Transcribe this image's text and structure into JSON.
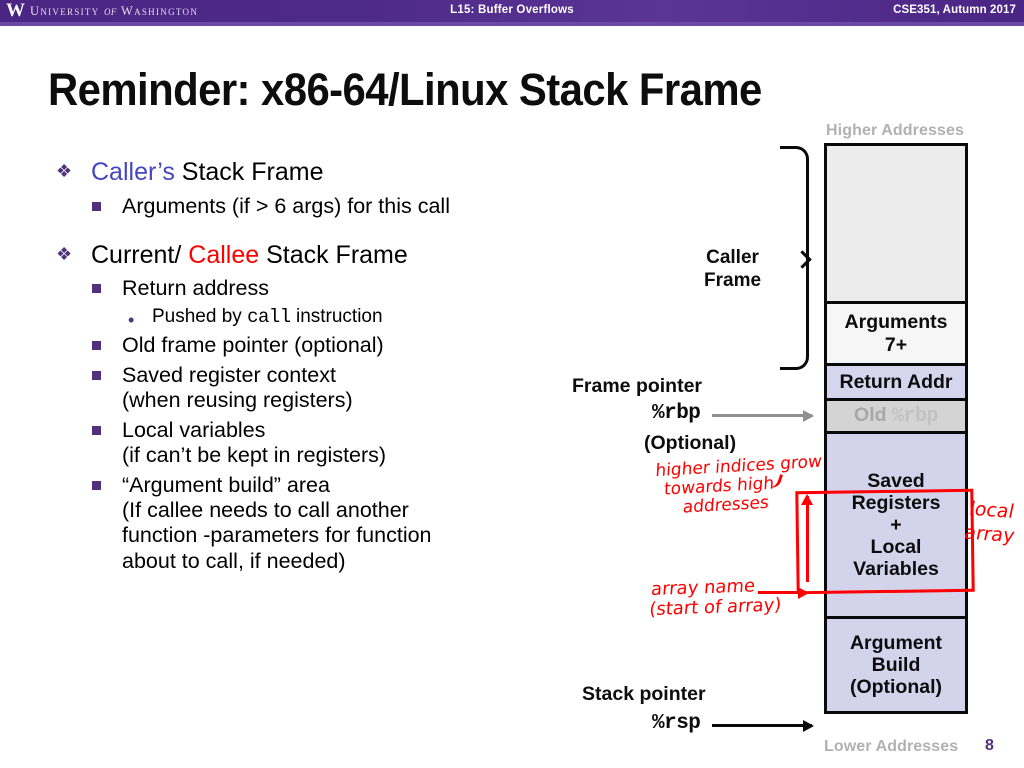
{
  "banner": {
    "logo_glyph": "W",
    "wordmark_pre": "University",
    "wordmark_of": "of",
    "wordmark_post": "Washington",
    "center": "L15:  Buffer Overflows",
    "right": "CSE351, Autumn 2017",
    "bg_color": "#4b2583"
  },
  "title": "Reminder:  x86-64/Linux Stack Frame",
  "bullets": {
    "caller_heading_hl": "Caller’s",
    "caller_heading_rest": " Stack Frame",
    "caller_sub": "Arguments (if > 6 args) for this call",
    "callee_heading_pre": "Current/ ",
    "callee_heading_hl": "Callee",
    "callee_heading_rest": " Stack Frame",
    "return_address": "Return address",
    "pushed_pre": "Pushed by ",
    "pushed_mono": "call",
    "pushed_post": " instruction",
    "old_frame_pointer": "Old frame pointer (optional)",
    "saved_reg_l1": "Saved register context",
    "saved_reg_l2": "(when reusing registers)",
    "local_vars_l1": "Local variables",
    "local_vars_l2": "(if can’t be kept in registers)",
    "arg_build_l1": "“Argument build” area",
    "arg_build_l2": "(If callee needs to call another",
    "arg_build_l3": "function -parameters for function",
    "arg_build_l4": "about to call, if needed)",
    "marker_level1": "❖",
    "marker_level3": "•",
    "color_blue": "#4545c4",
    "color_red": "#fe0000",
    "color_marker": "#51307e"
  },
  "diagram": {
    "higher_addresses": "Higher Addresses",
    "lower_addresses": "Lower Addresses",
    "caller_frame_l1": "Caller",
    "caller_frame_l2": "Frame",
    "frame_pointer_label": "Frame pointer",
    "frame_pointer_reg": "%rbp",
    "frame_pointer_optional": "(Optional)",
    "stack_pointer_label": "Stack pointer",
    "stack_pointer_reg": "%rsp",
    "cells": [
      {
        "id": "empty",
        "lines": [],
        "fill": "#ececec"
      },
      {
        "id": "arguments",
        "lines": [
          "Arguments",
          "7+"
        ],
        "fill": "#f6f6f6"
      },
      {
        "id": "return-addr",
        "lines": [
          "Return Addr"
        ],
        "fill": "#d5d5ee"
      },
      {
        "id": "old-rbp",
        "lines": [
          "Old ",
          "%rbp"
        ],
        "fill": "#d4d4d4"
      },
      {
        "id": "saved-registers",
        "lines": [
          "Saved",
          "Registers",
          "+",
          "Local",
          "Variables"
        ],
        "fill": "#d3d3ec"
      },
      {
        "id": "argument-build",
        "lines": [
          "Argument",
          "Build",
          "(Optional)"
        ],
        "fill": "#d3d3ec"
      }
    ]
  },
  "annotations": {
    "note_indices_l1": "higher indices grow",
    "note_indices_l2": "towards high",
    "note_indices_l3": "addresses",
    "note_array_l1": "array name",
    "note_array_l2": "(start of array)",
    "note_local_l1": "local",
    "note_local_l2": "array",
    "ink_color": "#ff0000"
  },
  "slide_number": "8"
}
